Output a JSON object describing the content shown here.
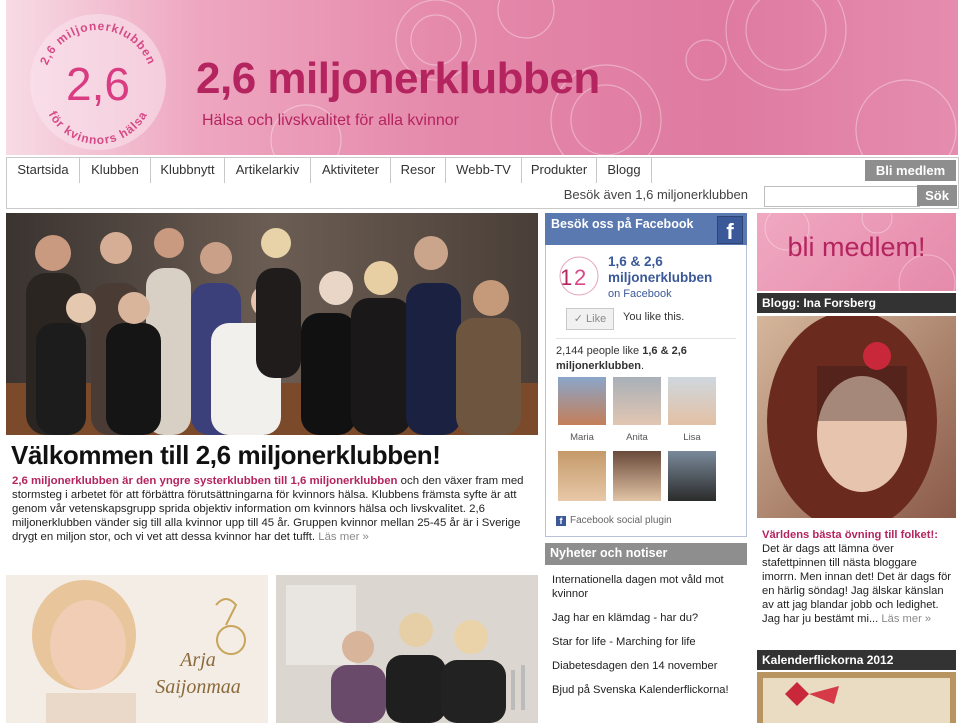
{
  "header": {
    "logo_number": "2,6",
    "logo_ring_top": "2,6 miljonerklubben",
    "logo_ring_bottom": "för kvinnors hälsa",
    "title": "2,6 miljonerklubben",
    "tagline": "Hälsa och livskvalitet för alla kvinnor"
  },
  "nav": {
    "items": [
      "Startsida",
      "Klubben",
      "Klubbnytt",
      "Artikelarkiv",
      "Aktiviteter",
      "Resor",
      "Webb-TV",
      "Produkter",
      "Blogg"
    ],
    "join_label": "Bli medlem"
  },
  "subnav": {
    "also_visit": "Besök även 1,6 miljonerklubben",
    "search_placeholder": "",
    "search_button": "Sök"
  },
  "main": {
    "welcome_heading": "Välkommen till 2,6 miljonerklubben!",
    "welcome_lead": "2,6 miljonerklubben är den yngre systerklubben till 1,6 miljonerklubben",
    "welcome_body": " och den växer fram med stormsteg i arbetet för att förbättra förutsättningarna för kvinnors hälsa. Klubbens främsta syfte är att genom vår vetenskapsgrupp sprida objektiv information om kvinnors hälsa och livskvalitet. 2,6 miljonerklubben vänder sig till alla kvinnor upp till 45 år. Gruppen kvinnor mellan 25-45 år är i Sverige drygt en miljon stor, och vi vet att dessa kvinnor har det tufft. ",
    "welcome_more": "Läs mer »",
    "thumb1_caption_line1": "Arja",
    "thumb1_caption_line2": "Saijonmaa"
  },
  "facebook": {
    "header": "Besök oss på Facebook",
    "fb_glyph": "f",
    "page_name": "1,6 & 2,6 miljonerklubben",
    "on_facebook": "on Facebook",
    "like_label": "Like",
    "you_like": "You like this.",
    "count_prefix": "2,144 people like ",
    "count_name": "1,6 & 2,6 miljonerklubben",
    "count_suffix": ".",
    "fans": [
      "Maria",
      "Anita",
      "Lisa"
    ],
    "plugin_label": "Facebook social plugin"
  },
  "news": {
    "header": "Nyheter och notiser",
    "items": [
      "Internationella dagen mot våld mot kvinnor",
      "Jag har en klämdag - har du?",
      "Star for life - Marching for life",
      "Diabetesdagen den 14 november",
      "Bjud på Svenska Kalenderflickorna!"
    ]
  },
  "sidebar": {
    "banner": "bli medlem!",
    "blog_header": "Blogg: Ina Forsberg",
    "blog_lead": "Världens bästa övning till folket!:",
    "blog_body": " Det är dags att lämna över stafettpinnen till nästa bloggare imorrn. Men innan det! Det är dags för en härlig söndag! Jag älskar känslan av att jag blandar jobb och ledighet. Jag har ju bestämt mi... ",
    "blog_more": "Läs mer »",
    "calendar_header": "Kalenderflickorna 2012"
  },
  "colors": {
    "brand": "#b4245f",
    "header_pink": "#e58aab",
    "facebook_blue": "#3b5998",
    "gray_button": "#8e8e8e"
  }
}
